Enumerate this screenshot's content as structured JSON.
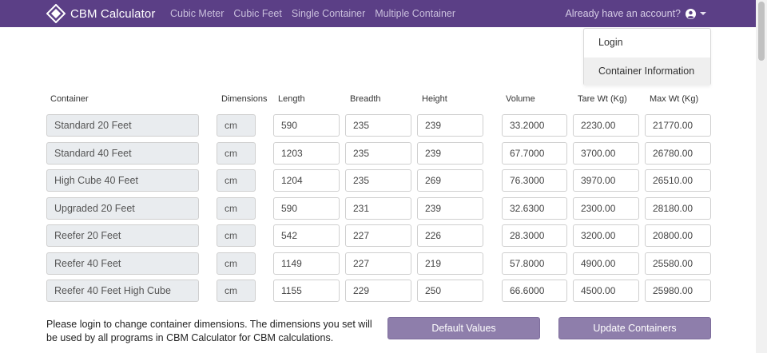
{
  "navbar": {
    "brand": "CBM Calculator",
    "links": [
      "Cubic Meter",
      "Cubic Feet",
      "Single Container",
      "Multiple Container"
    ],
    "account_text": "Already have an account?",
    "bg_color": "#5b3f86"
  },
  "dropdown": {
    "items": [
      "Login",
      "Container Information"
    ]
  },
  "table": {
    "headers": [
      "Container",
      "Dimensions",
      "Length",
      "Breadth",
      "Height",
      "Volume",
      "Tare Wt (Kg)",
      "Max Wt (Kg)"
    ],
    "rows": [
      {
        "name": "Standard 20 Feet",
        "unit": "cm",
        "length": "590",
        "breadth": "235",
        "height": "239",
        "volume": "33.2000",
        "tare": "2230.00",
        "max": "21770.00"
      },
      {
        "name": "Standard 40 Feet",
        "unit": "cm",
        "length": "1203",
        "breadth": "235",
        "height": "239",
        "volume": "67.7000",
        "tare": "3700.00",
        "max": "26780.00"
      },
      {
        "name": "High Cube 40 Feet",
        "unit": "cm",
        "length": "1204",
        "breadth": "235",
        "height": "269",
        "volume": "76.3000",
        "tare": "3970.00",
        "max": "26510.00"
      },
      {
        "name": "Upgraded 20 Feet",
        "unit": "cm",
        "length": "590",
        "breadth": "231",
        "height": "239",
        "volume": "32.6300",
        "tare": "2300.00",
        "max": "28180.00"
      },
      {
        "name": "Reefer 20 Feet",
        "unit": "cm",
        "length": "542",
        "breadth": "227",
        "height": "226",
        "volume": "28.3000",
        "tare": "3200.00",
        "max": "20800.00"
      },
      {
        "name": "Reefer 40 Feet",
        "unit": "cm",
        "length": "1149",
        "breadth": "227",
        "height": "219",
        "volume": "57.8000",
        "tare": "4900.00",
        "max": "25580.00"
      },
      {
        "name": "Reefer 40 Feet High Cube",
        "unit": "cm",
        "length": "1155",
        "breadth": "229",
        "height": "250",
        "volume": "66.6000",
        "tare": "4500.00",
        "max": "25980.00"
      }
    ]
  },
  "note": "Please login to change container dimensions. The dimensions you set will be used by all programs in CBM Calculator for CBM calculations.",
  "buttons": {
    "default": "Default Values",
    "update": "Update Containers"
  }
}
